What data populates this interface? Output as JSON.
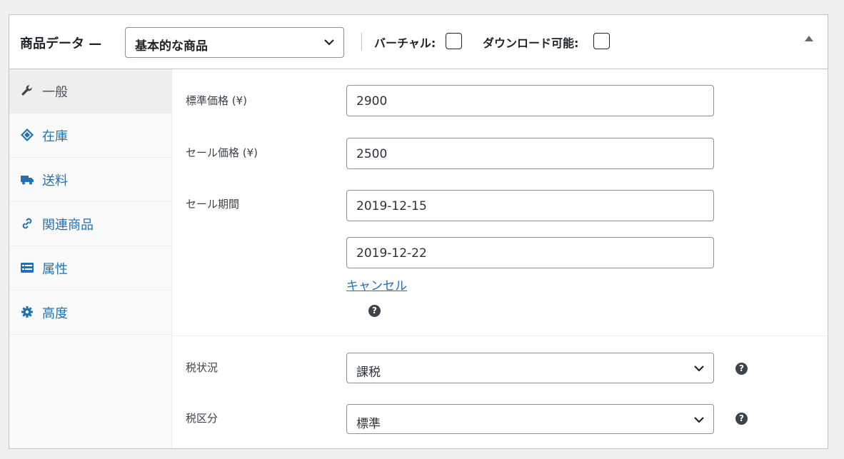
{
  "header": {
    "title": "商品データ —",
    "product_type": "基本的な商品",
    "virtual_label": "バーチャル:",
    "downloadable_label": "ダウンロード可能:"
  },
  "tabs": [
    {
      "label": "一般",
      "icon": "wrench-icon"
    },
    {
      "label": "在庫",
      "icon": "tag-icon"
    },
    {
      "label": "送料",
      "icon": "truck-icon"
    },
    {
      "label": "関連商品",
      "icon": "link-icon"
    },
    {
      "label": "属性",
      "icon": "list-icon"
    },
    {
      "label": "高度",
      "icon": "gear-icon"
    }
  ],
  "fields": {
    "regular_price_label": "標準価格 (¥)",
    "regular_price": "2900",
    "sale_price_label": "セール価格 (¥)",
    "sale_price": "2500",
    "sale_period_label": "セール期間",
    "sale_from": "2019-12-15",
    "sale_to": "2019-12-22",
    "cancel_label": "キャンセル",
    "tax_status_label": "税状況",
    "tax_status": "課税",
    "tax_class_label": "税区分",
    "tax_class": "標準",
    "help_glyph": "?"
  },
  "colors": {
    "link": "#2271b1",
    "border": "#8c8f94",
    "active_tab_bg": "#eeeeee"
  }
}
